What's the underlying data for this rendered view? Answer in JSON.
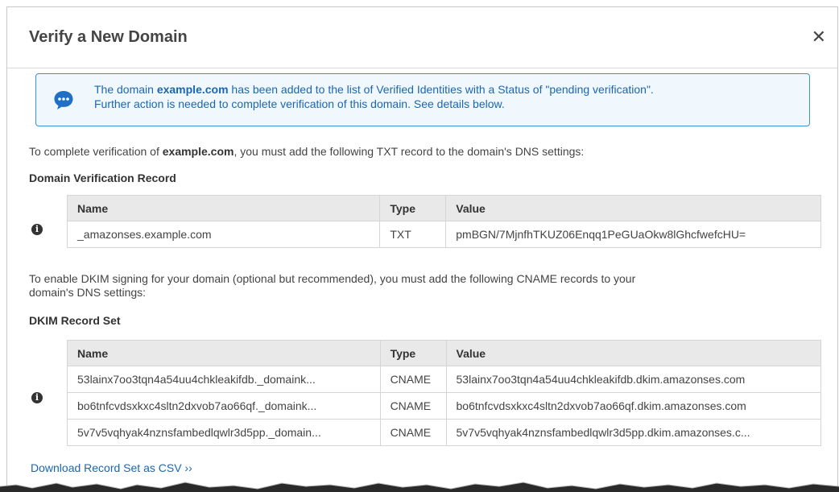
{
  "dialog": {
    "title": "Verify a New Domain",
    "close_glyph": "✕"
  },
  "notice": {
    "icon": "speech-bubble-icon",
    "text_before": "The domain ",
    "domain": "example.com",
    "text_after": " has been added to the list of Verified Identities with a Status of \"pending verification\".",
    "line2": "Further action is needed to complete verification of this domain. See details below."
  },
  "verification": {
    "intro_before": "To complete verification of ",
    "domain": "example.com",
    "intro_after": ", you must add the following TXT record to the domain's DNS settings:",
    "section_title": "Domain Verification Record",
    "columns": [
      "Name",
      "Type",
      "Value"
    ],
    "rows": [
      [
        "_amazonses.example.com",
        "TXT",
        "pmBGN/7MjnfhTKUZ06Enqq1PeGUaOkw8lGhcfwefcHU="
      ]
    ]
  },
  "dkim": {
    "intro_line1": "To enable DKIM signing for your domain (optional but recommended), you must add the following CNAME records to your",
    "intro_line2": "domain's DNS settings:",
    "section_title": "DKIM Record Set",
    "columns": [
      "Name",
      "Type",
      "Value"
    ],
    "rows": [
      [
        "53lainx7oo3tqn4a54uu4chkleakifdb._domaink...",
        "CNAME",
        "53lainx7oo3tqn4a54uu4chkleakifdb.dkim.amazonses.com"
      ],
      [
        "bo6tnfcvdsxkxc4sltn2dxvob7ao66qf._domaink...",
        "CNAME",
        "bo6tnfcvdsxkxc4sltn2dxvob7ao66qf.dkim.amazonses.com"
      ],
      [
        "5v7v5vqhyak4nznsfambedlqwlr3d5pp._domain...",
        "CNAME",
        "5v7v5vqhyak4nznsfambedlqwlr3d5pp.dkim.amazonses.c..."
      ]
    ]
  },
  "download_link": "Download Record Set as CSV ››",
  "colors": {
    "link": "#1a66b3",
    "notice_border": "#3c8fd8",
    "notice_bg": "#f1f8fd",
    "header_bg": "#e9e9e9"
  }
}
